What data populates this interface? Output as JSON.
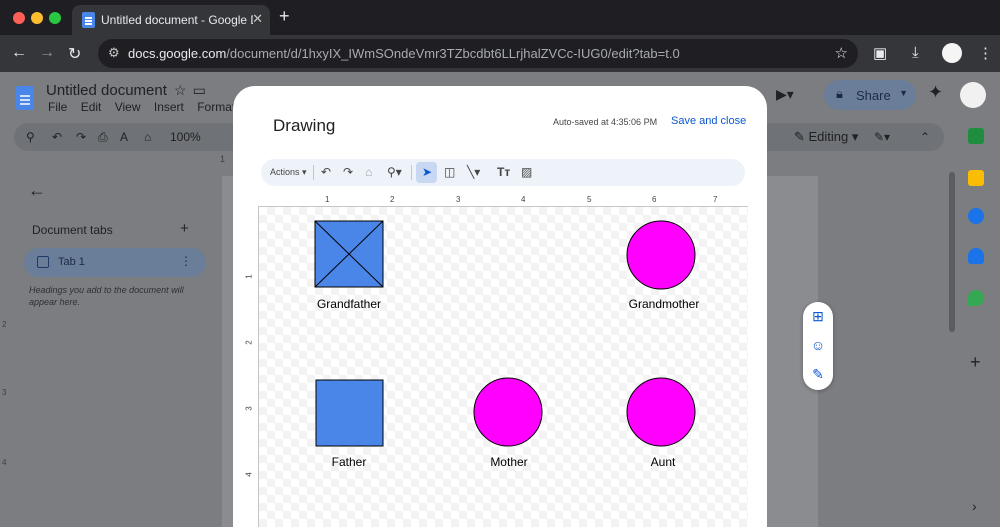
{
  "browser": {
    "tab_title": "Untitled document - Google Docs",
    "tab_close": "✕",
    "new_tab": "+",
    "url_host": "docs.google.com",
    "url_path": "/document/d/1hxyIX_IWmSOndeVmr3TZbcdbt6LLrjhalZVCc-IUG0/edit?tab=t.0",
    "colors": {
      "close": "#ff5f57",
      "minimize": "#febc2e",
      "maximize": "#28c840"
    }
  },
  "docs": {
    "title": "Untitled document",
    "menu": [
      "File",
      "Edit",
      "View",
      "Insert",
      "Format"
    ],
    "zoom": "100%",
    "mode": "Editing",
    "share_label": "Share",
    "sidebar": {
      "heading": "Document tabs",
      "add": "+",
      "tabs": [
        {
          "label": "Tab 1"
        }
      ],
      "hint": "Headings you add to the document will appear here."
    },
    "ruler_top_marks": [
      "1",
      "1",
      "2"
    ],
    "ruler_left_marks": [
      "1",
      "2",
      "3",
      "4"
    ]
  },
  "drawing": {
    "title": "Drawing",
    "autosave": "Auto-saved at 4:35:06 PM",
    "save_close": "Save and close",
    "actions_label": "Actions",
    "hruler_marks": [
      "1",
      "2",
      "3",
      "4",
      "5",
      "6",
      "7"
    ],
    "vruler_marks": [
      "1",
      "2",
      "3",
      "4"
    ],
    "shapes": [
      {
        "label": "Grandfather",
        "shape": "square-crossed",
        "fill": "#4a86e8"
      },
      {
        "label": "Grandmother",
        "shape": "circle",
        "fill": "#ff00ff"
      },
      {
        "label": "Father",
        "shape": "square",
        "fill": "#4a86e8"
      },
      {
        "label": "Mother",
        "shape": "circle",
        "fill": "#ff00ff"
      },
      {
        "label": "Aunt",
        "shape": "circle",
        "fill": "#ff00ff"
      }
    ]
  }
}
